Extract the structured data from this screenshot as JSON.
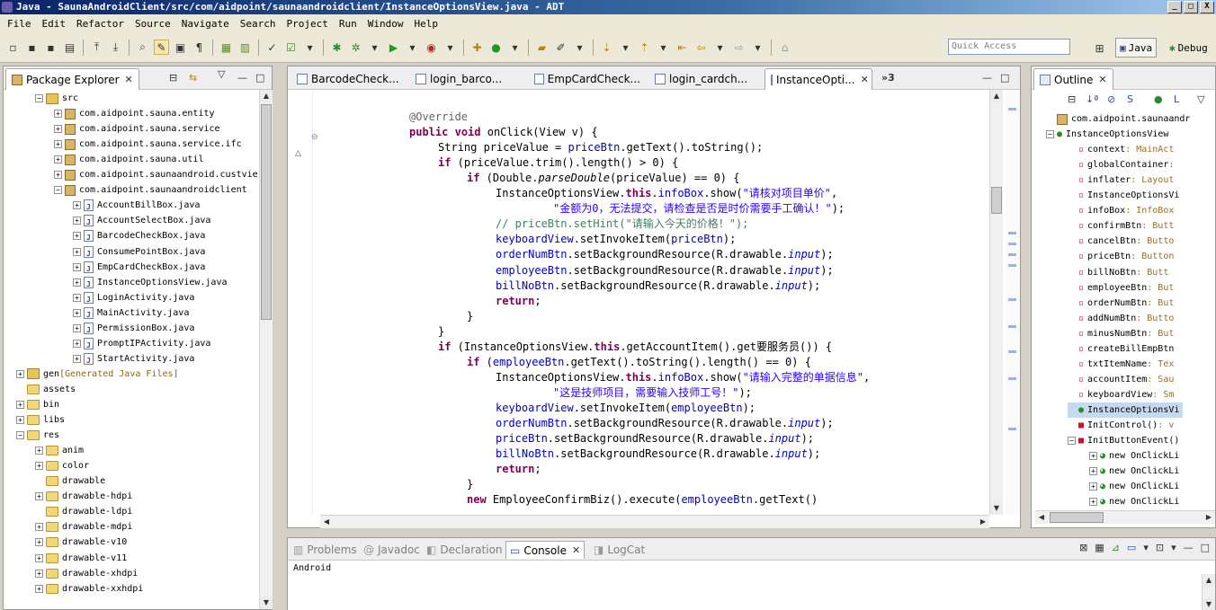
{
  "window": {
    "title": "Java - SaunaAndroidClient/src/com/aidpoint/saunaandroidclient/InstanceOptionsView.java - ADT",
    "controls": [
      "_",
      "□",
      "X"
    ]
  },
  "menu": [
    "File",
    "Edit",
    "Refactor",
    "Source",
    "Navigate",
    "Search",
    "Project",
    "Run",
    "Window",
    "Help"
  ],
  "toolbar": {
    "quick_access_placeholder": "Quick Access",
    "perspective_java": "Java",
    "perspective_debug": "Debug"
  },
  "package_explorer": {
    "tab_label": "Package Explorer",
    "tree": [
      {
        "label": "src",
        "level": 1,
        "icon": "src-folder-icon",
        "expanded": true
      },
      {
        "label": "com.aidpoint.sauna.entity",
        "level": 2,
        "icon": "package-icon",
        "expanded": false
      },
      {
        "label": "com.aidpoint.sauna.service",
        "level": 2,
        "icon": "package-icon",
        "expanded": false
      },
      {
        "label": "com.aidpoint.sauna.service.ifc",
        "level": 2,
        "icon": "package-icon",
        "expanded": false
      },
      {
        "label": "com.aidpoint.sauna.util",
        "level": 2,
        "icon": "package-icon",
        "expanded": false
      },
      {
        "label": "com.aidpoint.saunaandroid.custvie",
        "level": 2,
        "icon": "package-icon",
        "expanded": false
      },
      {
        "label": "com.aidpoint.saunaandroidclient",
        "level": 2,
        "icon": "package-icon",
        "expanded": true
      },
      {
        "label": "AccountBillBox.java",
        "level": 3,
        "icon": "java-file-icon",
        "expanded": false
      },
      {
        "label": "AccountSelectBox.java",
        "level": 3,
        "icon": "java-file-icon",
        "expanded": false
      },
      {
        "label": "BarcodeCheckBox.java",
        "level": 3,
        "icon": "java-file-icon",
        "expanded": false
      },
      {
        "label": "ConsumePointBox.java",
        "level": 3,
        "icon": "java-file-icon",
        "expanded": false
      },
      {
        "label": "EmpCardCheckBox.java",
        "level": 3,
        "icon": "java-file-icon",
        "expanded": false
      },
      {
        "label": "InstanceOptionsView.java",
        "level": 3,
        "icon": "java-file-icon",
        "expanded": false
      },
      {
        "label": "LoginActivity.java",
        "level": 3,
        "icon": "java-file-icon",
        "expanded": false
      },
      {
        "label": "MainActivity.java",
        "level": 3,
        "icon": "java-file-icon",
        "expanded": false
      },
      {
        "label": "PermissionBox.java",
        "level": 3,
        "icon": "java-file-icon",
        "expanded": false
      },
      {
        "label": "PromptIPActivity.java",
        "level": 3,
        "icon": "java-file-icon",
        "expanded": false
      },
      {
        "label": "StartActivity.java",
        "level": 3,
        "icon": "java-file-icon",
        "expanded": false
      },
      {
        "label": "gen",
        "suffix": "[Generated Java Files]",
        "level": 0,
        "icon": "src-folder-icon",
        "expanded": false
      },
      {
        "label": "assets",
        "level": 0,
        "icon": "folder-icon",
        "expanded": null
      },
      {
        "label": "bin",
        "level": 0,
        "icon": "folder-icon",
        "expanded": false
      },
      {
        "label": "libs",
        "level": 0,
        "icon": "folder-icon",
        "expanded": false
      },
      {
        "label": "res",
        "level": 0,
        "icon": "folder-icon",
        "expanded": true
      },
      {
        "label": "anim",
        "level": 1,
        "icon": "folder-icon",
        "expanded": false
      },
      {
        "label": "color",
        "level": 1,
        "icon": "folder-icon",
        "expanded": false
      },
      {
        "label": "drawable",
        "level": 1,
        "icon": "folder-icon",
        "expanded": null
      },
      {
        "label": "drawable-hdpi",
        "level": 1,
        "icon": "folder-icon",
        "expanded": false
      },
      {
        "label": "drawable-ldpi",
        "level": 1,
        "icon": "folder-icon",
        "expanded": null
      },
      {
        "label": "drawable-mdpi",
        "level": 1,
        "icon": "folder-icon",
        "expanded": false
      },
      {
        "label": "drawable-v10",
        "level": 1,
        "icon": "folder-icon",
        "expanded": false
      },
      {
        "label": "drawable-v11",
        "level": 1,
        "icon": "folder-icon",
        "expanded": false
      },
      {
        "label": "drawable-xhdpi",
        "level": 1,
        "icon": "folder-icon",
        "expanded": false
      },
      {
        "label": "drawable-xxhdpi",
        "level": 1,
        "icon": "folder-icon",
        "expanded": false
      }
    ]
  },
  "editor": {
    "tabs": [
      {
        "label": "BarcodeCheck...",
        "active": false
      },
      {
        "label": "login_barco...",
        "active": false
      },
      {
        "label": "EmpCardCheck...",
        "active": false
      },
      {
        "label": "login_cardch...",
        "active": false
      },
      {
        "label": "InstanceOpti...",
        "active": true
      }
    ],
    "overflow_count": "»3",
    "lines": [
      {
        "indent": 0,
        "tokens": [
          [
            "ann",
            "@Override"
          ]
        ]
      },
      {
        "indent": 0,
        "tokens": [
          [
            "kw",
            "public"
          ],
          [
            "",
            " "
          ],
          [
            "kw",
            "void"
          ],
          [
            "",
            " onClick(View v) {"
          ]
        ]
      },
      {
        "indent": 2,
        "tokens": [
          [
            "",
            "String priceValue = "
          ],
          [
            "fld",
            "priceBtn"
          ],
          [
            "",
            ".getText().toString();"
          ]
        ]
      },
      {
        "indent": 2,
        "tokens": [
          [
            "kw",
            "if"
          ],
          [
            "",
            " (priceValue.trim().length() > 0) {"
          ]
        ]
      },
      {
        "indent": 4,
        "tokens": [
          [
            "kw",
            "if"
          ],
          [
            "",
            " (Double."
          ],
          [
            "it",
            "parseDouble"
          ],
          [
            "",
            "(priceValue) == 0) {"
          ]
        ]
      },
      {
        "indent": 6,
        "tokens": [
          [
            "",
            "InstanceOptionsView."
          ],
          [
            "kw",
            "this"
          ],
          [
            "",
            "."
          ],
          [
            "fld",
            "infoBox"
          ],
          [
            "",
            ".show("
          ],
          [
            "str",
            "\"请核对项目单价\""
          ],
          [
            "",
            ","
          ]
        ]
      },
      {
        "indent": 10,
        "tokens": [
          [
            "str",
            "\"金额为0，无法提交，请检查是否是时价需要手工确认！\""
          ],
          [
            "",
            ");"
          ]
        ]
      },
      {
        "indent": 6,
        "tokens": [
          [
            "cmt",
            "// priceBtn.setHint(\"请输入今天的价格！\");"
          ]
        ]
      },
      {
        "indent": 6,
        "tokens": [
          [
            "fld",
            "keyboardView"
          ],
          [
            "",
            ".setInvokeItem("
          ],
          [
            "fld",
            "priceBtn"
          ],
          [
            "",
            ");"
          ]
        ]
      },
      {
        "indent": 6,
        "tokens": [
          [
            "fld",
            "orderNumBtn"
          ],
          [
            "",
            ".setBackgroundResource(R.drawable."
          ],
          [
            "itf",
            "input"
          ],
          [
            "",
            ");"
          ]
        ]
      },
      {
        "indent": 6,
        "tokens": [
          [
            "fld",
            "employeeBtn"
          ],
          [
            "",
            ".setBackgroundResource(R.drawable."
          ],
          [
            "itf",
            "input"
          ],
          [
            "",
            ");"
          ]
        ]
      },
      {
        "indent": 6,
        "tokens": [
          [
            "fld",
            "billNoBtn"
          ],
          [
            "",
            ".setBackgroundResource(R.drawable."
          ],
          [
            "itf",
            "input"
          ],
          [
            "",
            ");"
          ]
        ]
      },
      {
        "indent": 6,
        "tokens": [
          [
            "kw",
            "return"
          ],
          [
            "",
            ";"
          ]
        ]
      },
      {
        "indent": 4,
        "tokens": [
          [
            "",
            "}"
          ]
        ]
      },
      {
        "indent": 2,
        "tokens": [
          [
            "",
            "}"
          ]
        ]
      },
      {
        "indent": 2,
        "tokens": [
          [
            "kw",
            "if"
          ],
          [
            "",
            " (InstanceOptionsView."
          ],
          [
            "kw",
            "this"
          ],
          [
            "",
            ".getAccountItem().get要服务员()) {"
          ]
        ]
      },
      {
        "indent": 4,
        "tokens": [
          [
            "kw",
            "if"
          ],
          [
            "",
            " ("
          ],
          [
            "fld",
            "employeeBtn"
          ],
          [
            "",
            ".getText().toString().length() == 0) {"
          ]
        ]
      },
      {
        "indent": 6,
        "tokens": [
          [
            "",
            "InstanceOptionsView."
          ],
          [
            "kw",
            "this"
          ],
          [
            "",
            "."
          ],
          [
            "fld",
            "infoBox"
          ],
          [
            "",
            ".show("
          ],
          [
            "str",
            "\"请输入完整的单据信息\""
          ],
          [
            "",
            ","
          ]
        ]
      },
      {
        "indent": 10,
        "tokens": [
          [
            "str",
            "\"这是技师项目，需要输入技师工号！\""
          ],
          [
            "",
            ");"
          ]
        ]
      },
      {
        "indent": 6,
        "tokens": [
          [
            "fld",
            "keyboardView"
          ],
          [
            "",
            ".setInvokeItem("
          ],
          [
            "fld",
            "employeeBtn"
          ],
          [
            "",
            ");"
          ]
        ]
      },
      {
        "indent": 6,
        "tokens": [
          [
            "fld",
            "orderNumBtn"
          ],
          [
            "",
            ".setBackgroundResource(R.drawable."
          ],
          [
            "itf",
            "input"
          ],
          [
            "",
            ");"
          ]
        ]
      },
      {
        "indent": 6,
        "tokens": [
          [
            "fld",
            "priceBtn"
          ],
          [
            "",
            ".setBackgroundResource(R.drawable."
          ],
          [
            "itf",
            "input"
          ],
          [
            "",
            ");"
          ]
        ]
      },
      {
        "indent": 6,
        "tokens": [
          [
            "fld",
            "billNoBtn"
          ],
          [
            "",
            ".setBackgroundResource(R.drawable."
          ],
          [
            "itf",
            "input"
          ],
          [
            "",
            ");"
          ]
        ]
      },
      {
        "indent": 6,
        "tokens": [
          [
            "kw",
            "return"
          ],
          [
            "",
            ";"
          ]
        ]
      },
      {
        "indent": 4,
        "tokens": [
          [
            "",
            "}"
          ]
        ]
      },
      {
        "indent": 4,
        "tokens": [
          [
            "kw",
            "new"
          ],
          [
            "",
            " EmployeeConfirmBiz().execute("
          ],
          [
            "fld",
            "employeeBtn"
          ],
          [
            "",
            ".getText()"
          ]
        ]
      }
    ]
  },
  "outline": {
    "tab_label": "Outline",
    "items": [
      {
        "label": "com.aidpoint.saunaandr",
        "type": "",
        "icon": "import-icon",
        "level": 0
      },
      {
        "label": "InstanceOptionsView",
        "type": "",
        "icon": "class-icon",
        "level": 0,
        "expanded": true
      },
      {
        "label": "context",
        "type": " : MainAct",
        "icon": "field-private-icon",
        "level": 1
      },
      {
        "label": "globalContainer",
        "type": " : ",
        "icon": "field-private-icon",
        "level": 1
      },
      {
        "label": "inflater",
        "type": " : Layout",
        "icon": "field-private-icon",
        "level": 1
      },
      {
        "label": "InstanceOptionsVi",
        "type": "",
        "icon": "field-private-icon",
        "level": 1
      },
      {
        "label": "infoBox",
        "type": " : InfoBox",
        "icon": "field-private-icon",
        "level": 1
      },
      {
        "label": "confirmBtn",
        "type": " : Butt",
        "icon": "field-private-icon",
        "level": 1
      },
      {
        "label": "cancelBtn",
        "type": " : Butto",
        "icon": "field-private-icon",
        "level": 1
      },
      {
        "label": "priceBtn",
        "type": " : Button",
        "icon": "field-private-icon",
        "level": 1
      },
      {
        "label": "billNoBtn",
        "type": " : Butt",
        "icon": "field-private-icon",
        "level": 1
      },
      {
        "label": "employeeBtn",
        "type": " : But",
        "icon": "field-private-icon",
        "level": 1
      },
      {
        "label": "orderNumBtn",
        "type": " : But",
        "icon": "field-private-icon",
        "level": 1
      },
      {
        "label": "addNumBtn",
        "type": " : Butto",
        "icon": "field-private-icon",
        "level": 1
      },
      {
        "label": "minusNumBtn",
        "type": " : But",
        "icon": "field-private-icon",
        "level": 1
      },
      {
        "label": "createBillEmpBtn",
        "type": "",
        "icon": "field-private-icon",
        "level": 1
      },
      {
        "label": "txtItemName",
        "type": " : Tex",
        "icon": "field-private-icon",
        "level": 1
      },
      {
        "label": "accountItem",
        "type": " : Sau",
        "icon": "field-private-icon",
        "level": 1
      },
      {
        "label": "keyboardView",
        "type": " : Sm",
        "icon": "field-private-icon",
        "level": 1
      },
      {
        "label": "InstanceOptionsVi",
        "type": "",
        "icon": "constructor-icon",
        "level": 1,
        "selected": true
      },
      {
        "label": "InitControl()",
        "type": " : v",
        "icon": "method-private-icon",
        "level": 1
      },
      {
        "label": "InitButtonEvent()",
        "type": "",
        "icon": "method-private-icon",
        "level": 1,
        "expanded": true
      },
      {
        "label": "new OnClickLi",
        "type": "",
        "icon": "anonymous-class-icon",
        "level": 2
      },
      {
        "label": "new OnClickLi",
        "type": "",
        "icon": "anonymous-class-icon",
        "level": 2
      },
      {
        "label": "new OnClickLi",
        "type": "",
        "icon": "anonymous-class-icon",
        "level": 2
      },
      {
        "label": "new OnClickLi",
        "type": "",
        "icon": "anonymous-class-icon",
        "level": 2
      }
    ]
  },
  "bottom": {
    "tabs": [
      {
        "label": "Problems",
        "active": false,
        "icon": "problems-icon"
      },
      {
        "label": "Javadoc",
        "active": false,
        "icon": "at-icon"
      },
      {
        "label": "Declaration",
        "active": false,
        "icon": "declaration-icon"
      },
      {
        "label": "Console",
        "active": true,
        "icon": "console-icon"
      },
      {
        "label": "LogCat",
        "active": false,
        "icon": "logcat-icon"
      }
    ],
    "console_text": "Android"
  },
  "colors": {
    "keyword": "#7f0055",
    "field": "#0000c0",
    "string": "#2a00ff",
    "comment": "#3f7f5f",
    "selection": "#c5d9f1"
  }
}
